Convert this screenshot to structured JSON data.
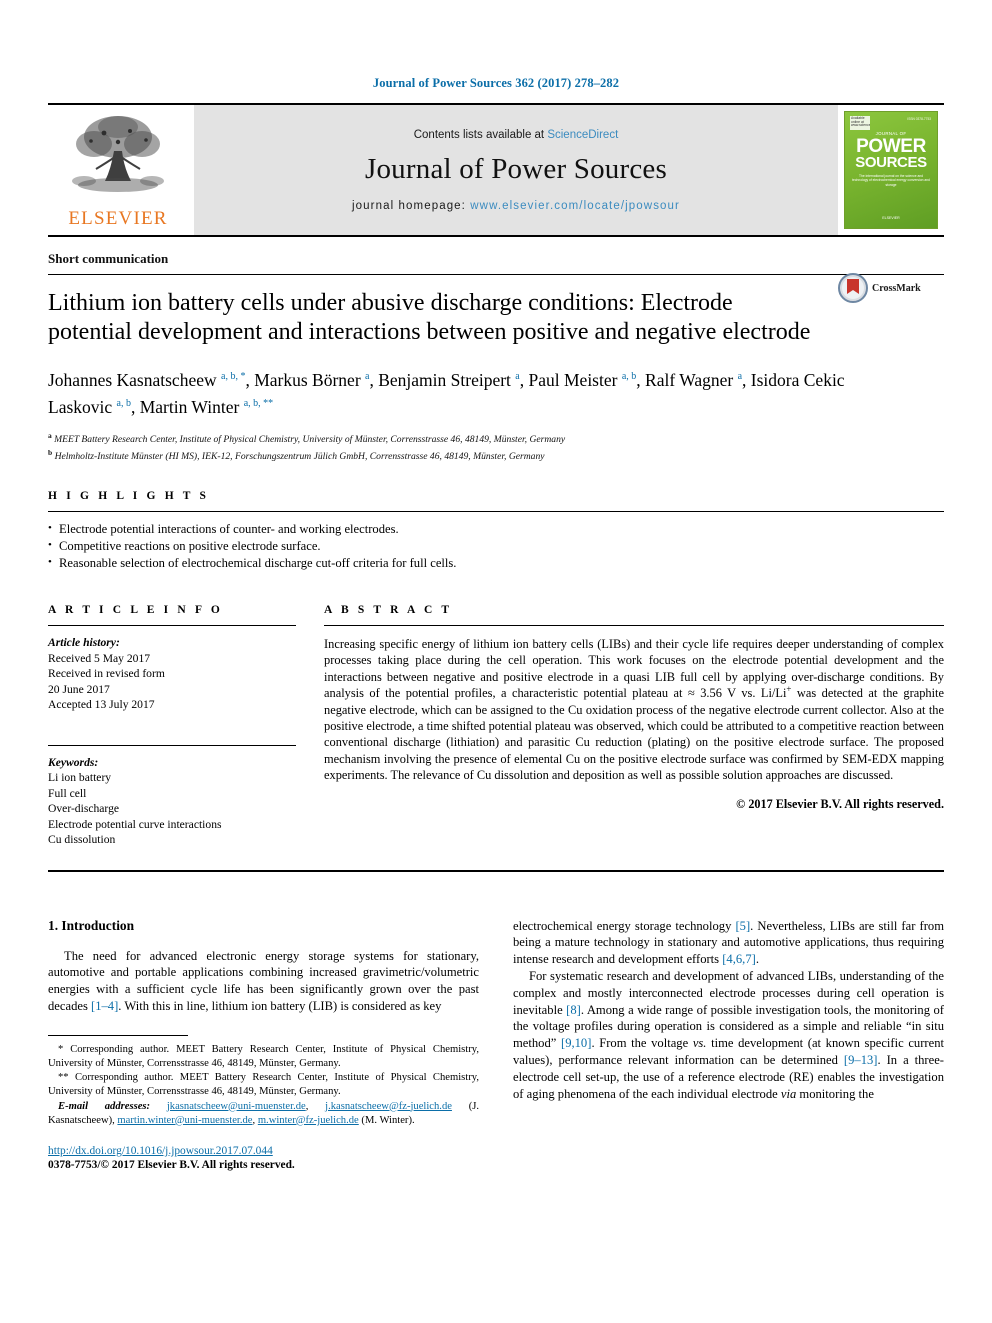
{
  "running_head": "Journal of Power Sources 362 (2017) 278–282",
  "masthead": {
    "contents_prefix": "Contents lists available at ",
    "sciencedirect": "ScienceDirect",
    "journal_name": "Journal of Power Sources",
    "homepage_prefix": "journal homepage: ",
    "homepage_url": "www.elsevier.com/locate/jpowsour",
    "publisher": "ELSEVIER",
    "cover": {
      "kicker": "JOURNAL OF",
      "word1": "POWER",
      "word2": "SOURCES",
      "subtitle": "The international journal on the science and technology of electrochemical energy conversion and storage",
      "issn": "ISSN 0378-7753",
      "corner_text": "Available online at www.sciencedirect.com",
      "bottom": "ELSEVIER"
    }
  },
  "article": {
    "doctype": "Short communication",
    "title": "Lithium ion battery cells under abusive discharge conditions: Electrode potential development and interactions between positive and negative electrode",
    "crossmark_label": "CrossMark",
    "authors": [
      {
        "name": "Johannes Kasnatscheew",
        "marks": "a, b, *",
        "sep": ", "
      },
      {
        "name": "Markus Börner",
        "marks": "a",
        "sep": ", "
      },
      {
        "name": "Benjamin Streipert",
        "marks": "a",
        "sep": ", "
      },
      {
        "name": "Paul Meister",
        "marks": "a, b",
        "sep": ", "
      },
      {
        "name": "Ralf Wagner",
        "marks": "a",
        "sep": ", "
      },
      {
        "name": "Isidora Cekic Laskovic",
        "marks": "a, b",
        "sep": ", "
      },
      {
        "name": "Martin Winter",
        "marks": "a, b, **",
        "sep": ""
      }
    ],
    "affiliations": [
      {
        "mark": "a",
        "text": "MEET Battery Research Center, Institute of Physical Chemistry, University of Münster, Corrensstrasse 46, 48149, Münster, Germany"
      },
      {
        "mark": "b",
        "text": "Helmholtz-Institute Münster (HI MS), IEK-12, Forschungszentrum Jülich GmbH, Corrensstrasse 46, 48149, Münster, Germany"
      }
    ]
  },
  "highlights": {
    "label": "H I G H L I G H T S",
    "items": [
      "Electrode potential interactions of counter- and working electrodes.",
      "Competitive reactions on positive electrode surface.",
      "Reasonable selection of electrochemical discharge cut-off criteria for full cells."
    ]
  },
  "article_info": {
    "label": "A R T I C L E  I N F O",
    "history_label": "Article history:",
    "history": [
      "Received 5 May 2017",
      "Received in revised form",
      "20 June 2017",
      "Accepted 13 July 2017"
    ],
    "keywords_label": "Keywords:",
    "keywords": [
      "Li ion battery",
      "Full cell",
      "Over-discharge",
      "Electrode potential curve interactions",
      "Cu dissolution"
    ]
  },
  "abstract": {
    "label": "A B S T R A C T",
    "part1": "Increasing specific energy of lithium ion battery cells (LIBs) and their cycle life requires deeper understanding of complex processes taking place during the cell operation. This work focuses on the electrode potential development and the interactions between negative and positive electrode in a quasi LIB full cell by applying over-discharge conditions. By analysis of the potential profiles, a characteristic potential plateau at ≈ 3.56 V vs. Li/Li",
    "sup1": "+",
    "part2": " was detected at the graphite negative electrode, which can be assigned to the Cu oxidation process of the negative electrode current collector. Also at the positive electrode, a time shifted potential plateau was observed, which could be attributed to a competitive reaction between conventional discharge (lithiation) and parasitic Cu reduction (plating) on the positive electrode surface. The proposed mechanism involving the presence of elemental Cu on the positive electrode surface was confirmed by SEM-EDX mapping experiments. The relevance of Cu dissolution and deposition as well as possible solution approaches are discussed.",
    "copyright": "© 2017 Elsevier B.V. All rights reserved."
  },
  "body": {
    "section_heading": "1. Introduction",
    "left_p1_a": "The need for advanced electronic energy storage systems for stationary, automotive and portable applications combining increased gravimetric/volumetric energies with a sufficient cycle life has been significantly grown over the past decades ",
    "left_p1_ref": "[1–4]",
    "left_p1_b": ". With this in line, lithium ion battery (LIB) is considered as key",
    "right_p1_a": "electrochemical energy storage technology ",
    "right_p1_ref1": "[5]",
    "right_p1_b": ". Nevertheless, LIBs are still far from being a mature technology in stationary and automotive applications, thus requiring intense research and development efforts ",
    "right_p1_ref2": "[4,6,7]",
    "right_p1_c": ".",
    "right_p2_a": "For systematic research and development of advanced LIBs, understanding of the complex and mostly interconnected electrode processes during cell operation is inevitable ",
    "right_p2_ref1": "[8]",
    "right_p2_b": ". Among a wide range of possible investigation tools, the monitoring of the voltage profiles during operation is considered as a simple and reliable “in situ method” ",
    "right_p2_ref2": "[9,10]",
    "right_p2_c": ". From the voltage ",
    "right_p2_it1": "vs.",
    "right_p2_d": " time development (at known specific current values), performance relevant information can be determined ",
    "right_p2_ref3": "[9–13]",
    "right_p2_e": ". In a three-electrode cell set-up, the use of a reference electrode (RE) enables the investigation of aging phenomena of the each individual electrode ",
    "right_p2_it2": "via",
    "right_p2_f": " monitoring the"
  },
  "footnotes": {
    "star1": "* Corresponding author. MEET Battery Research Center, Institute of Physical Chemistry, University of Münster, Corrensstrasse 46, 48149, Münster, Germany.",
    "star2": "** Corresponding author. MEET Battery Research Center, Institute of Physical Chemistry, University of Münster, Corrensstrasse 46, 48149, Münster, Germany.",
    "email_label": "E-mail addresses:",
    "email1": "jkasnatscheew@uni-muenster.de",
    "email2": "j.kasnatscheew@fz-juelich.de",
    "email1_owner": "(J. Kasnatscheew)",
    "email3": "martin.winter@uni-muenster.de",
    "email4": "m.winter@fz-juelich.de",
    "email3_owner": "(M. Winter).",
    "doi": "http://dx.doi.org/10.1016/j.jpowsour.2017.07.044",
    "issn_line": "0378-7753/© 2017 Elsevier B.V. All rights reserved."
  },
  "colors": {
    "link_blue": "#0b6ea8",
    "elsevier_orange": "#E87722",
    "cover_green": "#7ab52f",
    "masthead_gray": "#e3e3e3"
  }
}
